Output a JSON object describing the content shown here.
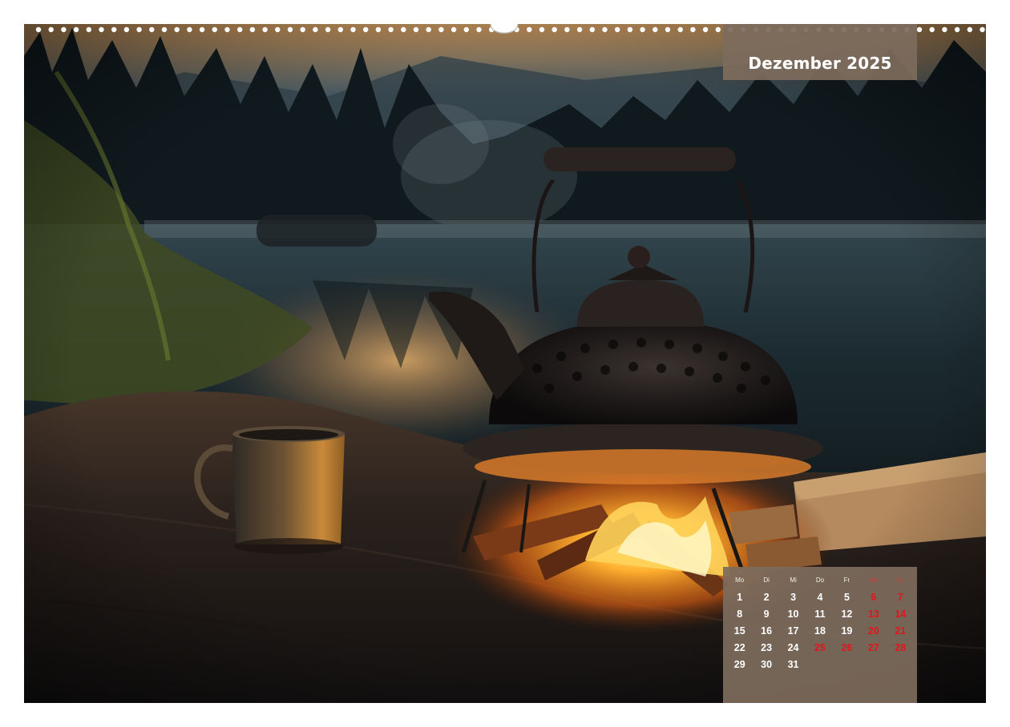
{
  "calendar": {
    "month_title": "Dezember 2025",
    "weekdays": [
      "Mo",
      "Di",
      "Mi",
      "Do",
      "Fr",
      "Sa",
      "So"
    ],
    "weeks": [
      [
        "1",
        "2",
        "3",
        "4",
        "5",
        "6",
        "7"
      ],
      [
        "8",
        "9",
        "10",
        "11",
        "12",
        "13",
        "14"
      ],
      [
        "15",
        "16",
        "17",
        "18",
        "19",
        "20",
        "21"
      ],
      [
        "22",
        "23",
        "24",
        "25",
        "26",
        "27",
        "28"
      ],
      [
        "29",
        "30",
        "31",
        "",
        "",
        "",
        ""
      ]
    ],
    "holidays": [
      "25",
      "26"
    ]
  },
  "colors": {
    "box_background": "#7d6c5c",
    "weekend_red": "#e0161b",
    "text_white": "#ffffff"
  },
  "photo": {
    "subject": "campfire-kettle-lake-dusk"
  }
}
